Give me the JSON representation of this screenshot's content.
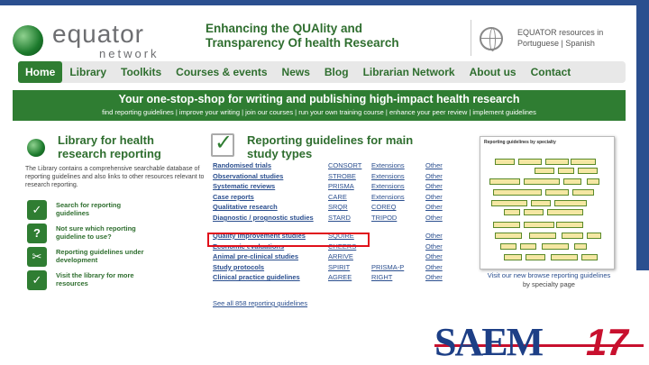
{
  "header": {
    "logo_word": "equator",
    "logo_sub": "network",
    "tagline_line1": "Enhancing the QUAlity and",
    "tagline_line2": "Transparency Of health Research",
    "lang_text": "EQUATOR resources in Portuguese | Spanish"
  },
  "nav": {
    "items": [
      "Home",
      "Library",
      "Toolkits",
      "Courses & events",
      "News",
      "Blog",
      "Librarian Network",
      "About us",
      "Contact"
    ],
    "active": "Home"
  },
  "banner": {
    "title": "Your one-stop-shop for writing and publishing high-impact health research",
    "links": "find reporting guidelines | improve your writing | join our courses | run your own training course | enhance your peer review | implement guidelines"
  },
  "library": {
    "title": "Library for health research reporting",
    "description": "The Library contains a comprehensive searchable database of reporting guidelines and also links to other resources relevant to research reporting.",
    "actions": [
      {
        "icon": "✓",
        "label": "Search for reporting guidelines"
      },
      {
        "icon": "?",
        "label": "Not sure which reporting guideline to use?"
      },
      {
        "icon": "✂",
        "label": "Reporting guidelines under development"
      },
      {
        "icon": "✓",
        "label": "Visit the library for more resources"
      }
    ]
  },
  "guidelines": {
    "title": "Reporting guidelines for main study types",
    "rows": [
      [
        "Randomised trials",
        "CONSORT",
        "Extensions",
        "Other"
      ],
      [
        "Observational studies",
        "STROBE",
        "Extensions",
        "Other"
      ],
      [
        "Systematic reviews",
        "PRISMA",
        "Extensions",
        "Other"
      ],
      [
        "Case reports",
        "CARE",
        "Extensions",
        "Other"
      ],
      [
        "Qualitative research",
        "SRQR",
        "COREQ",
        "Other"
      ],
      [
        "Diagnostic / prognostic studies",
        "STARD",
        "TRIPOD",
        "Other"
      ],
      [
        "Quality improvement studies",
        "SQUIRE",
        "",
        "Other"
      ],
      [
        "Economic evaluations",
        "CHEERS",
        "",
        "Other"
      ],
      [
        "Animal pre-clinical studies",
        "ARRIVE",
        "",
        "Other"
      ],
      [
        "Study protocols",
        "SPIRIT",
        "PRISMA-P",
        "Other"
      ],
      [
        "Clinical practice guidelines",
        "AGREE",
        "RIGHT",
        "Other"
      ]
    ],
    "see_all": "See all 858 reporting guidelines"
  },
  "panel": {
    "heading": "Reporting guidelines by specialty",
    "caption_line1": "Visit our new browse reporting guidelines",
    "caption_line2": "by specialty page"
  },
  "footer": {
    "logo_text": "SAEM",
    "logo_num": "17"
  }
}
